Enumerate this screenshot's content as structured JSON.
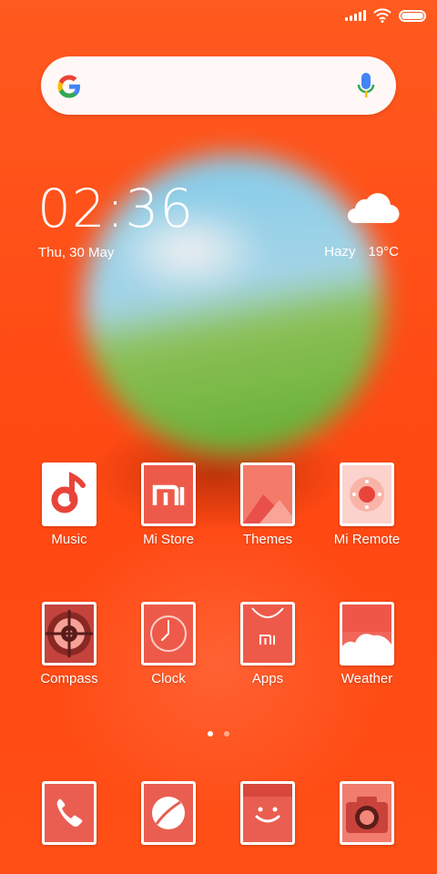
{
  "clock": {
    "time": "02:36",
    "date": "Thu, 30 May"
  },
  "weather": {
    "condition": "Hazy",
    "temperature": "19°C",
    "icon": "cloud-icon"
  },
  "search": {
    "logo": "google-icon",
    "voice": "microphone-icon"
  },
  "apps_row1": [
    {
      "label": "Music",
      "icon": "music-icon"
    },
    {
      "label": "Mi Store",
      "icon": "mi-store-icon"
    },
    {
      "label": "Themes",
      "icon": "themes-icon"
    },
    {
      "label": "Mi Remote",
      "icon": "remote-icon"
    }
  ],
  "apps_row2": [
    {
      "label": "Compass",
      "icon": "compass-icon"
    },
    {
      "label": "Clock",
      "icon": "clock-icon"
    },
    {
      "label": "Apps",
      "icon": "apps-store-icon"
    },
    {
      "label": "Weather",
      "icon": "weather-icon"
    }
  ],
  "dock": [
    {
      "icon": "phone-icon"
    },
    {
      "icon": "browser-icon"
    },
    {
      "icon": "messages-icon"
    },
    {
      "icon": "camera-icon"
    }
  ],
  "pager": {
    "pages": 2,
    "current": 1
  },
  "colors": {
    "accent": "#ff4a14",
    "icon_fill": "#ee5a4a"
  }
}
